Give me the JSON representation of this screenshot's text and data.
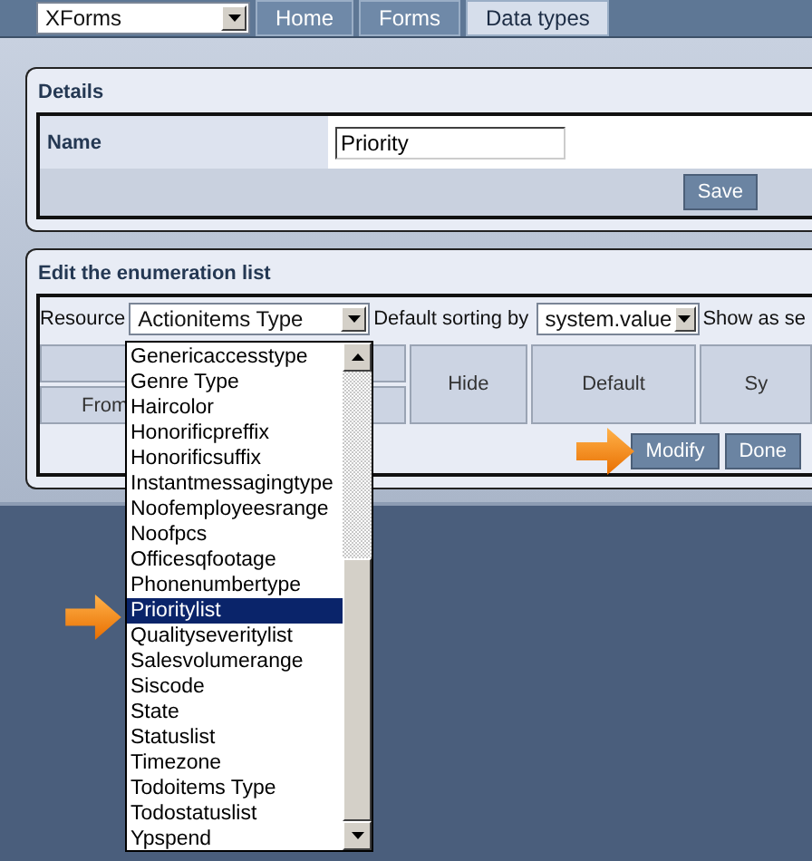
{
  "nav": {
    "app_select": "XForms",
    "tabs": [
      {
        "label": "Home",
        "selected": false
      },
      {
        "label": "Forms",
        "selected": false
      },
      {
        "label": "Data types",
        "selected": true
      }
    ]
  },
  "details": {
    "title": "Details",
    "name_label": "Name",
    "name_value": "Priority",
    "save": "Save"
  },
  "enumeration": {
    "title": "Edit the enumeration list",
    "resource_label": "Resource",
    "resource_value": "Actionitems Type",
    "sorting_label": "Default sorting by",
    "sorting_value": "system.value",
    "show_label": "Show as se",
    "first_column": "From",
    "columns": [
      "Hide",
      "Default",
      "Sy"
    ],
    "buttons": [
      "Modify",
      "Done"
    ]
  },
  "dropdown": {
    "items": [
      {
        "label": "Genericaccesstype",
        "selected": false
      },
      {
        "label": "Genre Type",
        "selected": false
      },
      {
        "label": "Haircolor",
        "selected": false
      },
      {
        "label": "Honorificpreffix",
        "selected": false
      },
      {
        "label": "Honorificsuffix",
        "selected": false
      },
      {
        "label": "Instantmessagingtype",
        "selected": false
      },
      {
        "label": "Noofemployeesrange",
        "selected": false
      },
      {
        "label": "Noofpcs",
        "selected": false
      },
      {
        "label": "Officesqfootage",
        "selected": false
      },
      {
        "label": "Phonenumbertype",
        "selected": false
      },
      {
        "label": "Prioritylist",
        "selected": true
      },
      {
        "label": "Qualityseveritylist",
        "selected": false
      },
      {
        "label": "Salesvolumerange",
        "selected": false
      },
      {
        "label": "Siscode",
        "selected": false
      },
      {
        "label": "State",
        "selected": false
      },
      {
        "label": "Statuslist",
        "selected": false
      },
      {
        "label": "Timezone",
        "selected": false
      },
      {
        "label": "Todoitems Type",
        "selected": false
      },
      {
        "label": "Todostatuslist",
        "selected": false
      },
      {
        "label": "Ypspend",
        "selected": false
      }
    ]
  }
}
